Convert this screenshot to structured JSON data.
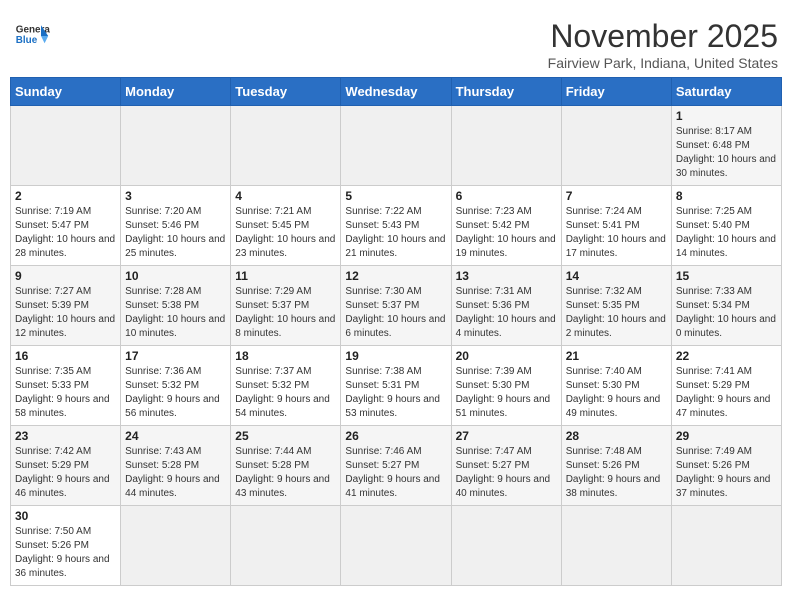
{
  "header": {
    "logo_general": "General",
    "logo_blue": "Blue",
    "month_title": "November 2025",
    "location": "Fairview Park, Indiana, United States"
  },
  "weekdays": [
    "Sunday",
    "Monday",
    "Tuesday",
    "Wednesday",
    "Thursday",
    "Friday",
    "Saturday"
  ],
  "weeks": [
    [
      {
        "day": "",
        "info": ""
      },
      {
        "day": "",
        "info": ""
      },
      {
        "day": "",
        "info": ""
      },
      {
        "day": "",
        "info": ""
      },
      {
        "day": "",
        "info": ""
      },
      {
        "day": "",
        "info": ""
      },
      {
        "day": "1",
        "info": "Sunrise: 8:17 AM\nSunset: 6:48 PM\nDaylight: 10 hours and 30 minutes."
      }
    ],
    [
      {
        "day": "2",
        "info": "Sunrise: 7:19 AM\nSunset: 5:47 PM\nDaylight: 10 hours and 28 minutes."
      },
      {
        "day": "3",
        "info": "Sunrise: 7:20 AM\nSunset: 5:46 PM\nDaylight: 10 hours and 25 minutes."
      },
      {
        "day": "4",
        "info": "Sunrise: 7:21 AM\nSunset: 5:45 PM\nDaylight: 10 hours and 23 minutes."
      },
      {
        "day": "5",
        "info": "Sunrise: 7:22 AM\nSunset: 5:43 PM\nDaylight: 10 hours and 21 minutes."
      },
      {
        "day": "6",
        "info": "Sunrise: 7:23 AM\nSunset: 5:42 PM\nDaylight: 10 hours and 19 minutes."
      },
      {
        "day": "7",
        "info": "Sunrise: 7:24 AM\nSunset: 5:41 PM\nDaylight: 10 hours and 17 minutes."
      },
      {
        "day": "8",
        "info": "Sunrise: 7:25 AM\nSunset: 5:40 PM\nDaylight: 10 hours and 14 minutes."
      }
    ],
    [
      {
        "day": "9",
        "info": "Sunrise: 7:27 AM\nSunset: 5:39 PM\nDaylight: 10 hours and 12 minutes."
      },
      {
        "day": "10",
        "info": "Sunrise: 7:28 AM\nSunset: 5:38 PM\nDaylight: 10 hours and 10 minutes."
      },
      {
        "day": "11",
        "info": "Sunrise: 7:29 AM\nSunset: 5:37 PM\nDaylight: 10 hours and 8 minutes."
      },
      {
        "day": "12",
        "info": "Sunrise: 7:30 AM\nSunset: 5:37 PM\nDaylight: 10 hours and 6 minutes."
      },
      {
        "day": "13",
        "info": "Sunrise: 7:31 AM\nSunset: 5:36 PM\nDaylight: 10 hours and 4 minutes."
      },
      {
        "day": "14",
        "info": "Sunrise: 7:32 AM\nSunset: 5:35 PM\nDaylight: 10 hours and 2 minutes."
      },
      {
        "day": "15",
        "info": "Sunrise: 7:33 AM\nSunset: 5:34 PM\nDaylight: 10 hours and 0 minutes."
      }
    ],
    [
      {
        "day": "16",
        "info": "Sunrise: 7:35 AM\nSunset: 5:33 PM\nDaylight: 9 hours and 58 minutes."
      },
      {
        "day": "17",
        "info": "Sunrise: 7:36 AM\nSunset: 5:32 PM\nDaylight: 9 hours and 56 minutes."
      },
      {
        "day": "18",
        "info": "Sunrise: 7:37 AM\nSunset: 5:32 PM\nDaylight: 9 hours and 54 minutes."
      },
      {
        "day": "19",
        "info": "Sunrise: 7:38 AM\nSunset: 5:31 PM\nDaylight: 9 hours and 53 minutes."
      },
      {
        "day": "20",
        "info": "Sunrise: 7:39 AM\nSunset: 5:30 PM\nDaylight: 9 hours and 51 minutes."
      },
      {
        "day": "21",
        "info": "Sunrise: 7:40 AM\nSunset: 5:30 PM\nDaylight: 9 hours and 49 minutes."
      },
      {
        "day": "22",
        "info": "Sunrise: 7:41 AM\nSunset: 5:29 PM\nDaylight: 9 hours and 47 minutes."
      }
    ],
    [
      {
        "day": "23",
        "info": "Sunrise: 7:42 AM\nSunset: 5:29 PM\nDaylight: 9 hours and 46 minutes."
      },
      {
        "day": "24",
        "info": "Sunrise: 7:43 AM\nSunset: 5:28 PM\nDaylight: 9 hours and 44 minutes."
      },
      {
        "day": "25",
        "info": "Sunrise: 7:44 AM\nSunset: 5:28 PM\nDaylight: 9 hours and 43 minutes."
      },
      {
        "day": "26",
        "info": "Sunrise: 7:46 AM\nSunset: 5:27 PM\nDaylight: 9 hours and 41 minutes."
      },
      {
        "day": "27",
        "info": "Sunrise: 7:47 AM\nSunset: 5:27 PM\nDaylight: 9 hours and 40 minutes."
      },
      {
        "day": "28",
        "info": "Sunrise: 7:48 AM\nSunset: 5:26 PM\nDaylight: 9 hours and 38 minutes."
      },
      {
        "day": "29",
        "info": "Sunrise: 7:49 AM\nSunset: 5:26 PM\nDaylight: 9 hours and 37 minutes."
      }
    ],
    [
      {
        "day": "30",
        "info": "Sunrise: 7:50 AM\nSunset: 5:26 PM\nDaylight: 9 hours and 36 minutes."
      },
      {
        "day": "",
        "info": ""
      },
      {
        "day": "",
        "info": ""
      },
      {
        "day": "",
        "info": ""
      },
      {
        "day": "",
        "info": ""
      },
      {
        "day": "",
        "info": ""
      },
      {
        "day": "",
        "info": ""
      }
    ]
  ]
}
